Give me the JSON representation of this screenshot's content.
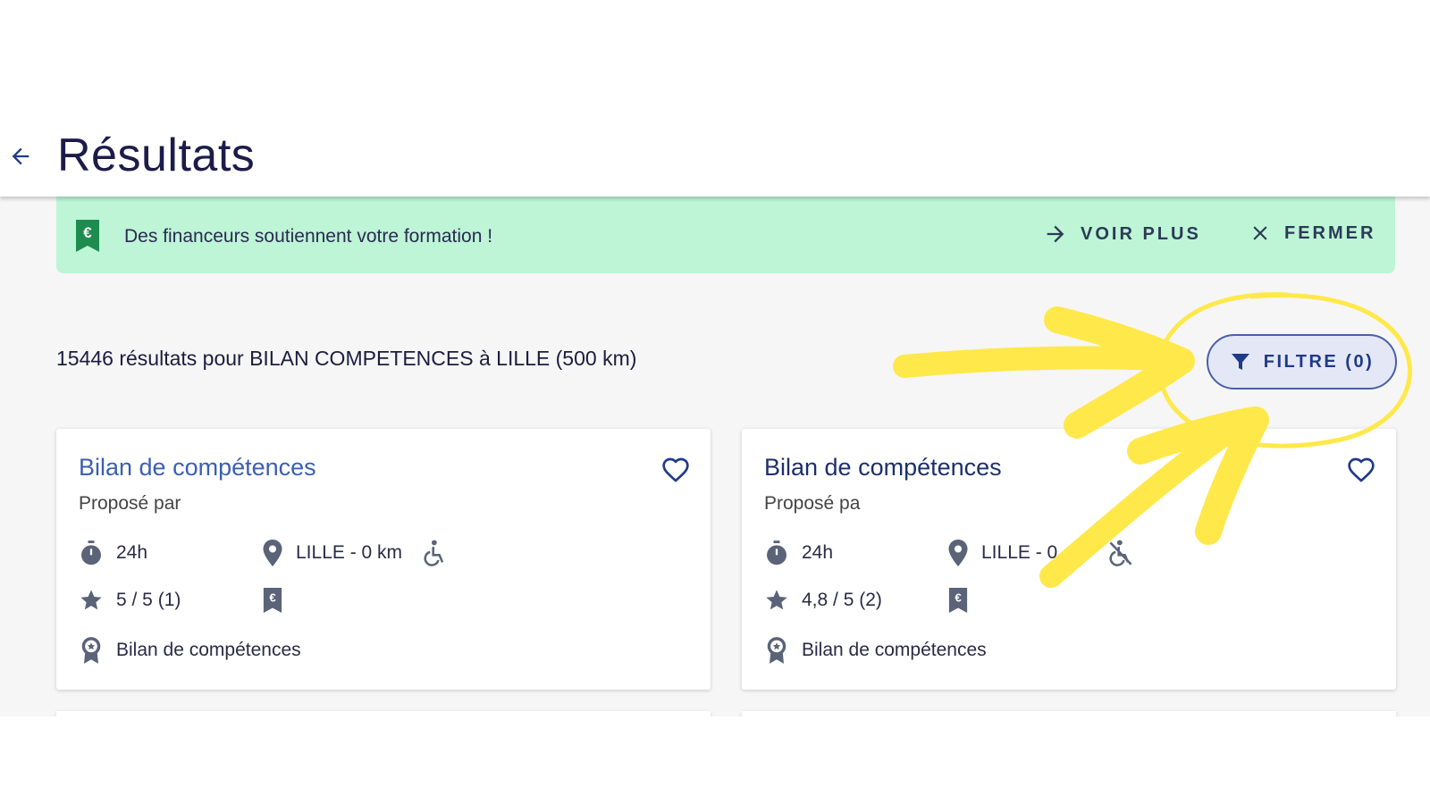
{
  "header": {
    "title": "Résultats",
    "back_icon": "arrow-left-icon"
  },
  "banner": {
    "text": "Des financeurs soutiennent votre formation !",
    "more_label": "VOIR PLUS",
    "close_label": "FERMER",
    "background": "#bdf5d6"
  },
  "results": {
    "summary": "15446 résultats pour BILAN COMPETENCES à LILLE (500 km)"
  },
  "filter": {
    "label": "FILTRE (0)"
  },
  "cards": [
    {
      "title": "Bilan de compétences",
      "provider": "Proposé par",
      "duration": "24h",
      "location": "LILLE - 0 km",
      "rating": "5 / 5 (1)",
      "certification": "Bilan de compétences",
      "accessible": true
    },
    {
      "title": "Bilan de compétences",
      "provider": "Proposé pa",
      "duration": "24h",
      "location": "LILLE - 0",
      "rating": "4,8 / 5 (2)",
      "certification": "Bilan de compétences",
      "accessible": false
    }
  ],
  "colors": {
    "accent": "#1f3a8a",
    "highlight": "#ffe84a",
    "page_bg": "#f6f6f6"
  }
}
